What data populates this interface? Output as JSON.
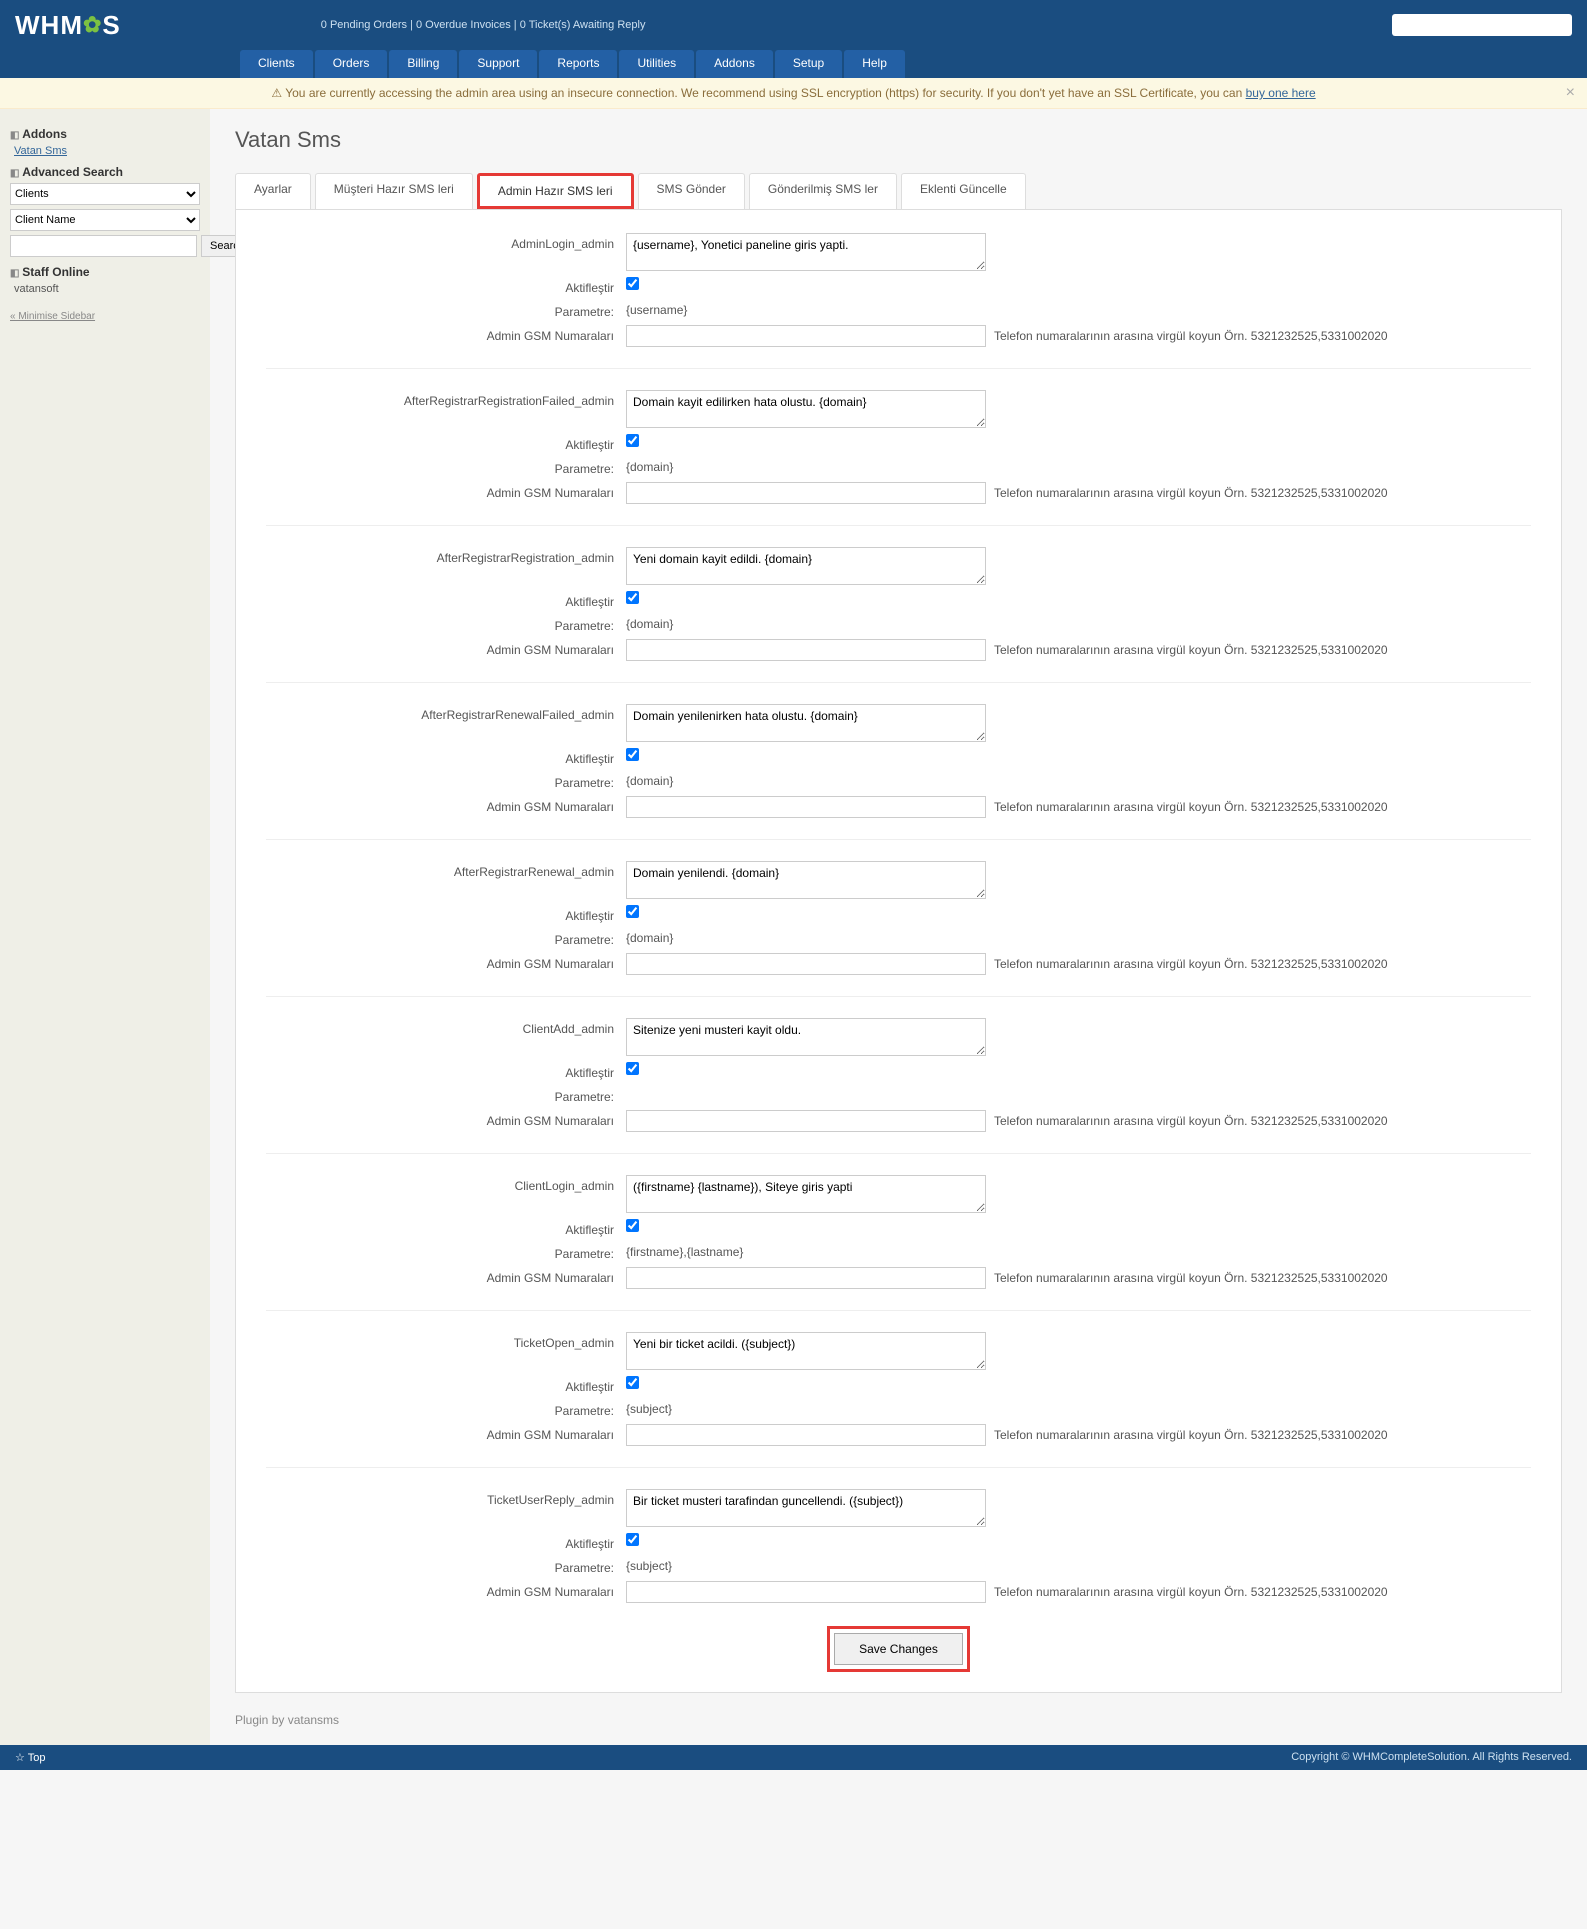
{
  "brand": "WHMCS",
  "header_stats": {
    "pending": "0 Pending Orders",
    "overdue": "0 Overdue Invoices",
    "tickets": "0 Ticket(s) Awaiting Reply"
  },
  "nav": [
    "Clients",
    "Orders",
    "Billing",
    "Support",
    "Reports",
    "Utilities",
    "Addons",
    "Setup",
    "Help"
  ],
  "ssl_warning": {
    "icon": "⚠",
    "text": "You are currently accessing the admin area using an insecure connection. We recommend using SSL encryption (https) for security. If you don't yet have an SSL Certificate, you can ",
    "link": "buy one here"
  },
  "sidebar": {
    "addons_h": "Addons",
    "addon_link": "Vatan Sms",
    "adv_h": "Advanced Search",
    "sel1": "Clients",
    "sel2": "Client Name",
    "search_btn": "Search",
    "staff_h": "Staff Online",
    "staff_user": "vatansoft",
    "minimise": "« Minimise Sidebar"
  },
  "page_title": "Vatan Sms",
  "tabs": [
    "Ayarlar",
    "Müşteri Hazır SMS leri",
    "Admin Hazır SMS leri",
    "SMS Gönder",
    "Gönderilmiş SMS ler",
    "Eklenti Güncelle"
  ],
  "labels": {
    "aktif": "Aktifleştir",
    "param": "Parametre:",
    "gsm": "Admin GSM Numaraları",
    "gsm_hint": "Telefon numaralarının arasına virgül koyun Örn. 5321232525,5331002020"
  },
  "sections": [
    {
      "name": "AdminLogin_admin",
      "msg": "{username}, Yonetici paneline giris yapti.",
      "active": true,
      "param": "{username}",
      "gsm": ""
    },
    {
      "name": "AfterRegistrarRegistrationFailed_admin",
      "msg": "Domain kayit edilirken hata olustu. {domain}",
      "active": true,
      "param": "{domain}",
      "gsm": ""
    },
    {
      "name": "AfterRegistrarRegistration_admin",
      "msg": "Yeni domain kayit edildi. {domain}",
      "active": true,
      "param": "{domain}",
      "gsm": ""
    },
    {
      "name": "AfterRegistrarRenewalFailed_admin",
      "msg": "Domain yenilenirken hata olustu. {domain}",
      "active": true,
      "param": "{domain}",
      "gsm": ""
    },
    {
      "name": "AfterRegistrarRenewal_admin",
      "msg": "Domain yenilendi. {domain}",
      "active": true,
      "param": "{domain}",
      "gsm": ""
    },
    {
      "name": "ClientAdd_admin",
      "msg": "Sitenize yeni musteri kayit oldu.",
      "active": true,
      "param": "",
      "gsm": ""
    },
    {
      "name": "ClientLogin_admin",
      "msg": "({firstname} {lastname}), Siteye giris yapti",
      "active": true,
      "param": "{firstname},{lastname}",
      "gsm": ""
    },
    {
      "name": "TicketOpen_admin",
      "msg": "Yeni bir ticket acildi. ({subject})",
      "active": true,
      "param": "{subject}",
      "gsm": ""
    },
    {
      "name": "TicketUserReply_admin",
      "msg": "Bir ticket musteri tarafindan guncellendi. ({subject})",
      "active": true,
      "param": "{subject}",
      "gsm": ""
    }
  ],
  "save_btn": "Save Changes",
  "plugin_by": "Plugin by vatansms",
  "footer": {
    "top": "☆ Top",
    "copy": "Copyright © WHMCompleteSolution. All Rights Reserved."
  }
}
